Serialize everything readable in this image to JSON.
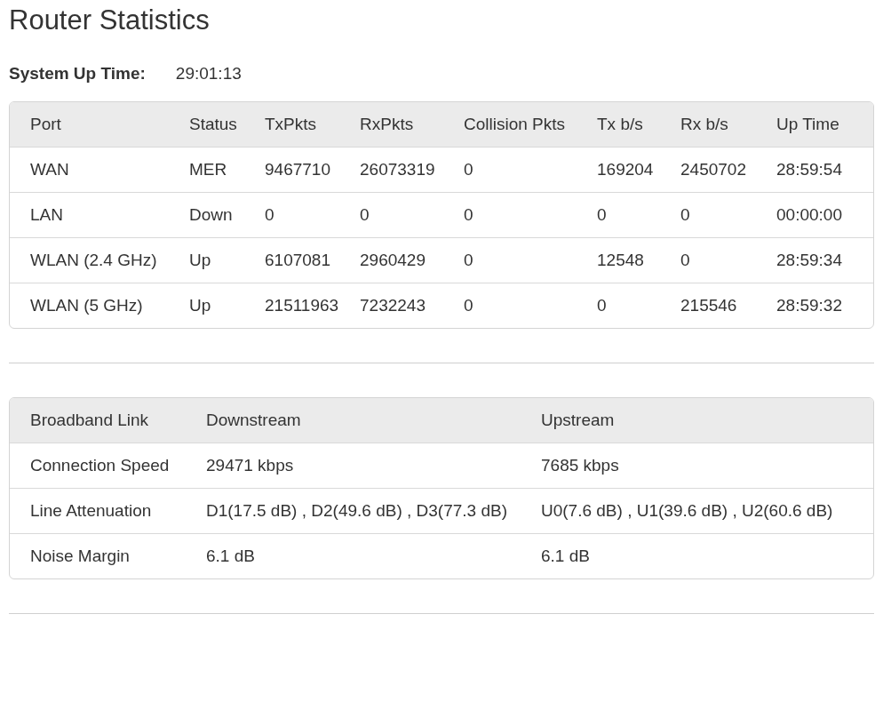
{
  "title": "Router Statistics",
  "system_up_time": {
    "label": "System Up Time:",
    "value": "29:01:13"
  },
  "port_table": {
    "columns": [
      "Port",
      "Status",
      "TxPkts",
      "RxPkts",
      "Collision Pkts",
      "Tx b/s",
      "Rx b/s",
      "Up Time"
    ],
    "rows": [
      [
        "WAN",
        "MER",
        "9467710",
        "26073319",
        "0",
        "169204",
        "2450702",
        "28:59:54"
      ],
      [
        "LAN",
        "Down",
        "0",
        "0",
        "0",
        "0",
        "0",
        "00:00:00"
      ],
      [
        "WLAN (2.4 GHz)",
        "Up",
        "6107081",
        "2960429",
        "0",
        "12548",
        "0",
        "28:59:34"
      ],
      [
        "WLAN (5 GHz)",
        "Up",
        "21511963",
        "7232243",
        "0",
        "0",
        "215546",
        "28:59:32"
      ]
    ]
  },
  "broadband_table": {
    "columns": [
      "Broadband Link",
      "Downstream",
      "Upstream"
    ],
    "rows": [
      [
        "Connection Speed",
        "29471 kbps",
        "7685 kbps"
      ],
      [
        "Line Attenuation",
        "D1(17.5 dB) , D2(49.6 dB) , D3(77.3 dB)",
        "U0(7.6 dB) , U1(39.6 dB) , U2(60.6 dB)"
      ],
      [
        "Noise Margin",
        "6.1 dB",
        "6.1 dB"
      ]
    ]
  }
}
